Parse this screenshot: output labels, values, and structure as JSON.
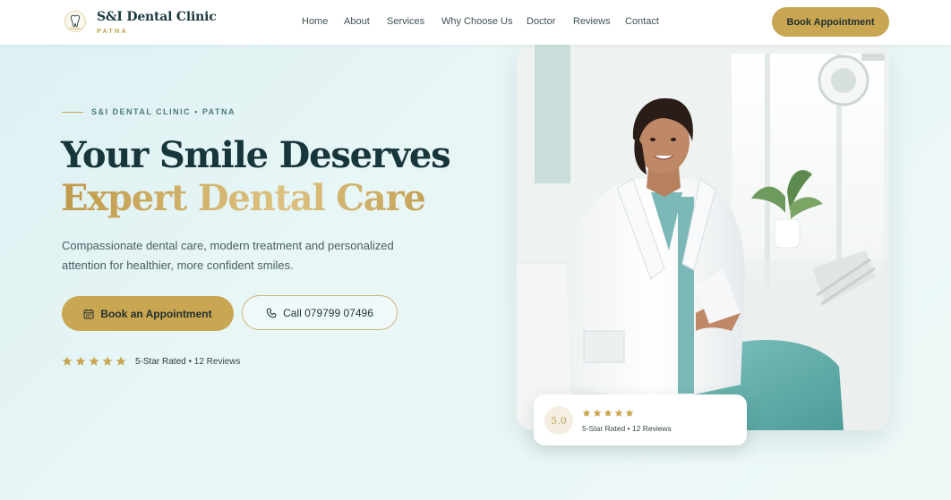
{
  "brand": {
    "name": "S&I Dental Clinic",
    "location": "PATNA"
  },
  "nav": {
    "links": [
      "Home",
      "About",
      "Services",
      "Why Choose Us",
      "Doctor",
      "Reviews",
      "Contact"
    ],
    "cta": "Book Appointment"
  },
  "hero": {
    "eyebrow": "S&I DENTAL CLINIC • PATNA",
    "headline_line1": "Your Smile Deserves",
    "headline_line2": "Expert Dental Care",
    "lead": "Compassionate dental care, modern treatment and personalized attention for healthier, more confident smiles.",
    "book_label": "Book an Appointment",
    "call_label": "Call 079799 07496",
    "rating_label": "5-Star Rated",
    "reviews_text": "• 12 Reviews",
    "star_count": 5
  },
  "review_card": {
    "score": "5.0",
    "star_count": 5,
    "text": "5-Star Rated • 12 Reviews"
  },
  "icons": {
    "logo": "tooth-logo-icon",
    "book": "calendar-icon",
    "call": "phone-icon",
    "star": "star-icon"
  },
  "colors": {
    "gold": "#c8a652",
    "dark_teal": "#17363b",
    "background": "#e3f3f4"
  }
}
